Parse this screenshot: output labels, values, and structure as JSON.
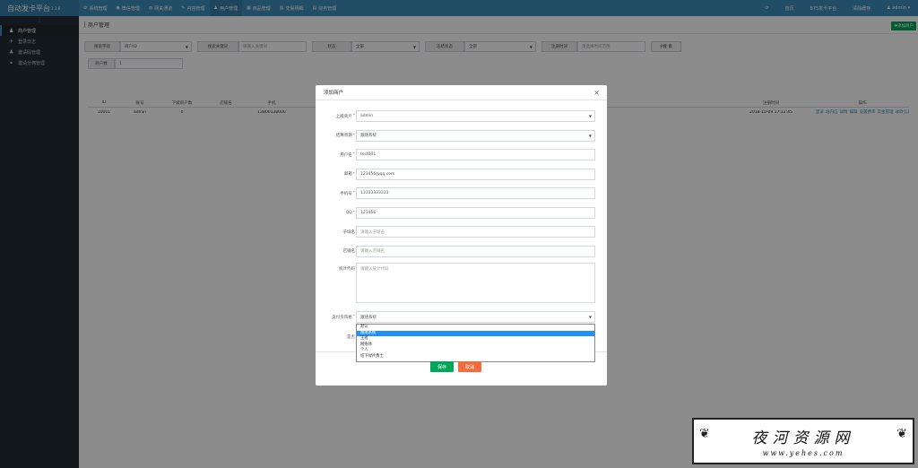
{
  "app": {
    "brand": "自动发卡平台",
    "version": "2.1.8"
  },
  "topnav": [
    {
      "icon": "gear-icon",
      "glyph": "⚙",
      "label": "系统管理"
    },
    {
      "icon": "chat-icon",
      "glyph": "◉",
      "label": "微信管理"
    },
    {
      "icon": "globe-icon",
      "glyph": "◍",
      "label": "网关通道"
    },
    {
      "icon": "edit-icon",
      "glyph": "✎",
      "label": "内容管理"
    },
    {
      "icon": "users-icon",
      "glyph": "♟",
      "label": "用户管理"
    },
    {
      "icon": "shop-icon",
      "glyph": "▦",
      "label": "商品管理"
    },
    {
      "icon": "chart-icon",
      "glyph": "▥",
      "label": "交易明细"
    },
    {
      "icon": "finance-icon",
      "glyph": "▤",
      "label": "财务管理"
    }
  ],
  "topright": {
    "refresh": "⟳",
    "home": "首页",
    "platform": "875发卡平台",
    "clear_cache": "清除缓存",
    "user": "admin"
  },
  "sidebar": {
    "toggle": "⋮",
    "items": [
      {
        "icon": "users-icon",
        "glyph": "♟",
        "label": "商户管理"
      },
      {
        "icon": "login-icon",
        "glyph": "✈",
        "label": "登录日志"
      },
      {
        "icon": "invite-icon",
        "glyph": "♣",
        "label": "邀请码管理"
      },
      {
        "icon": "link-icon",
        "glyph": "⚭",
        "label": "邀请分佣管理"
      }
    ]
  },
  "page": {
    "title": "商户管理",
    "add_button": "添加商户"
  },
  "search": {
    "field_label": "搜索字段",
    "field_value": "商户ID",
    "keyword_label": "搜索关键词",
    "keyword_placeholder": "请输入关键词",
    "status_label": "状态",
    "status_value": "全部",
    "freeze_label": "冻结状态",
    "freeze_value": "全部",
    "time_label": "注册时间",
    "time_placeholder": "请选择时间范围",
    "search_button": "搜 索",
    "count_label": "商户数",
    "count_value": "1"
  },
  "table": {
    "headers": [
      "ID",
      "账号",
      "下级商户数",
      "店铺名",
      "手机",
      "",
      "",
      "",
      "注册时间",
      "操作"
    ],
    "rows": [
      {
        "id": "10001",
        "account": "admin",
        "sub_count": "0",
        "shop": "",
        "phone": "13800138000",
        "reg_time": "2018-10-09 17:12:45",
        "actions": [
          "登录",
          "站内信",
          "详情",
          "编辑",
          "设置费率",
          "资金管理",
          "收款信息",
          "删除"
        ]
      }
    ]
  },
  "modal": {
    "title": "添加商户",
    "close": "×",
    "fields": [
      {
        "label": "上级商户",
        "required": true,
        "value": "admin",
        "type": "select"
      },
      {
        "label": "结算周期",
        "required": true,
        "value": "跟随系统",
        "type": "select"
      },
      {
        "label": "用户名",
        "required": true,
        "value": "test001",
        "type": "text"
      },
      {
        "label": "邮箱",
        "required": true,
        "value": "123456@qq.com",
        "type": "text"
      },
      {
        "label": "手机号",
        "required": true,
        "value": "13333333333",
        "type": "text"
      },
      {
        "label": "QQ",
        "required": true,
        "value": "123456",
        "type": "text"
      },
      {
        "label": "子域名",
        "required": false,
        "placeholder": "请输入子域名",
        "type": "text"
      },
      {
        "label": "店铺名",
        "required": false,
        "placeholder": "请输入店铺名",
        "type": "text"
      }
    ],
    "stats_label": "统计代码",
    "stats_placeholder": "请输入统计代码",
    "pay_label": "支付页风格",
    "pay_value": "跟随系统",
    "hidden_label": "是否",
    "dropdown_options": [
      "默认",
      "跟随系统",
      "王者",
      "网络体",
      "个人",
      "纸下绿片勇士"
    ],
    "dropdown_selected": 1,
    "save": "保存",
    "cancel": "取消"
  },
  "watermark": {
    "main": "夜河资源网",
    "url": "www.yehes.com"
  }
}
